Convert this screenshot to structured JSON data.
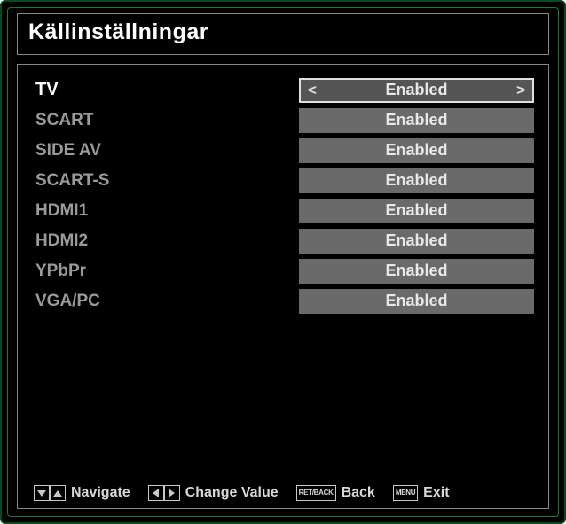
{
  "title": "Källinställningar",
  "sources": [
    {
      "label": "TV",
      "value": "Enabled",
      "selected": true
    },
    {
      "label": "SCART",
      "value": "Enabled",
      "selected": false
    },
    {
      "label": "SIDE AV",
      "value": "Enabled",
      "selected": false
    },
    {
      "label": "SCART-S",
      "value": "Enabled",
      "selected": false
    },
    {
      "label": "HDMI1",
      "value": "Enabled",
      "selected": false
    },
    {
      "label": "HDMI2",
      "value": "Enabled",
      "selected": false
    },
    {
      "label": "YPbPr",
      "value": "Enabled",
      "selected": false
    },
    {
      "label": "VGA/PC",
      "value": "Enabled",
      "selected": false
    }
  ],
  "footer": {
    "navigate": "Navigate",
    "change": "Change Value",
    "back_key": "RET/BACK",
    "back": "Back",
    "menu_key": "MENU",
    "exit": "Exit"
  }
}
